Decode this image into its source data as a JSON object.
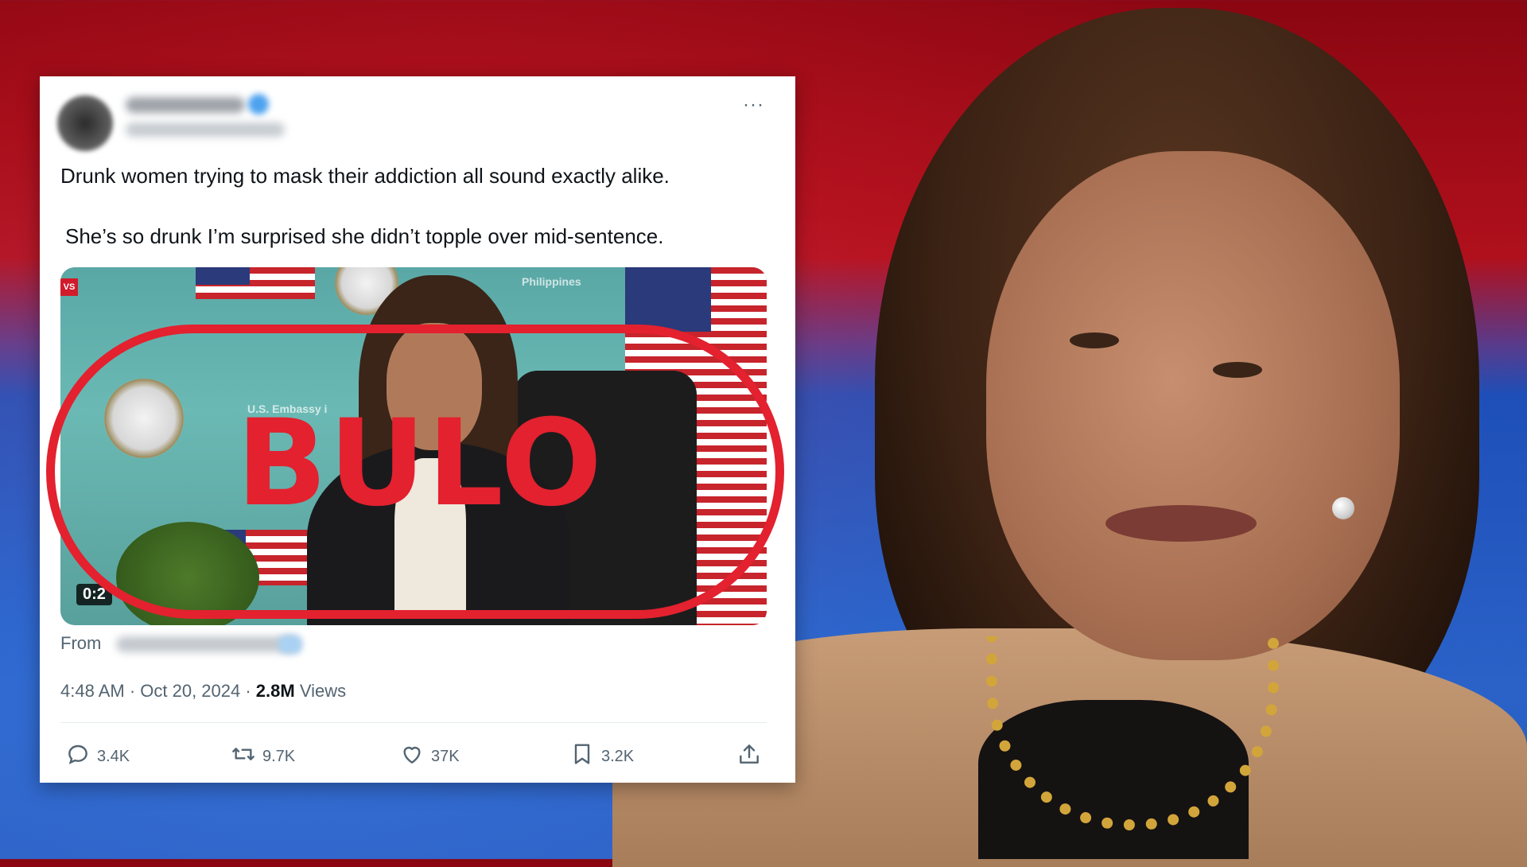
{
  "tweet": {
    "line1": "Drunk women trying to mask their addiction all sound exactly alike.",
    "line2": "She’s so drunk I’m surprised she didn’t topple over mid-sentence.",
    "more_label": "···",
    "media": {
      "duration": "0:2",
      "news_tag": "VS",
      "embassy_text": "U.S. Embassy i",
      "embassy_text_2": "Philippines"
    },
    "from_label": "From",
    "time": "4:48 AM · Oct 20, 2024 · ",
    "views_count": "2.8M",
    "views_label": " Views",
    "actions": {
      "replies": "3.4K",
      "retweets": "9.7K",
      "likes": "37K",
      "bookmarks": "3.2K"
    }
  },
  "stamp": {
    "text": "BULO",
    "color": "#e3212f"
  },
  "colors": {
    "background_top": "#8a0611",
    "background_bottom": "#2a5cc0",
    "text_primary": "#0f1419",
    "text_secondary": "#536471"
  }
}
